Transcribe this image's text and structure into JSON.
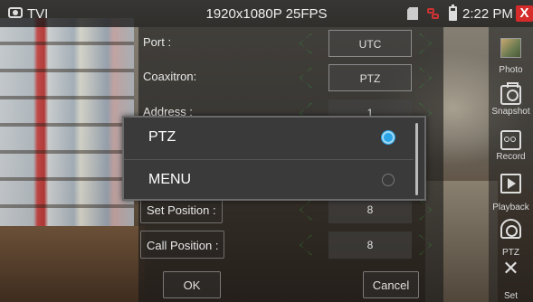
{
  "statusbar": {
    "mode": "TVI",
    "resolution": "1920x1080P 25FPS",
    "time": "2:22 PM",
    "close": "X",
    "icons": [
      "camera-icon",
      "sd-card-icon",
      "network-icon",
      "battery-icon",
      "close-icon"
    ]
  },
  "form": {
    "rows": [
      {
        "label": "Port :",
        "value": "UTC"
      },
      {
        "label": "Coaxitron:",
        "value": "PTZ"
      },
      {
        "label": "Address :",
        "value": "1"
      },
      {
        "label": "Set Position :",
        "value": "8"
      },
      {
        "label": "Call Position :",
        "value": "8"
      }
    ],
    "ok": "OK",
    "cancel": "Cancel"
  },
  "popup": {
    "options": [
      {
        "label": "PTZ",
        "selected": true
      },
      {
        "label": "MENU",
        "selected": false
      }
    ]
  },
  "sidebar": {
    "items": [
      {
        "label": "Photo",
        "icon": "photo-thumbnail"
      },
      {
        "label": "Snapshot",
        "icon": "camera-icon"
      },
      {
        "label": "Record",
        "icon": "record-icon"
      },
      {
        "label": "Playback",
        "icon": "play-icon"
      },
      {
        "label": "PTZ",
        "icon": "ptz-camera-icon"
      },
      {
        "label": "Set",
        "icon": "tools-icon"
      }
    ]
  },
  "colors": {
    "accent": "#2aa4e6",
    "close": "#d62b2b",
    "arrows": "#2f9f3a"
  }
}
